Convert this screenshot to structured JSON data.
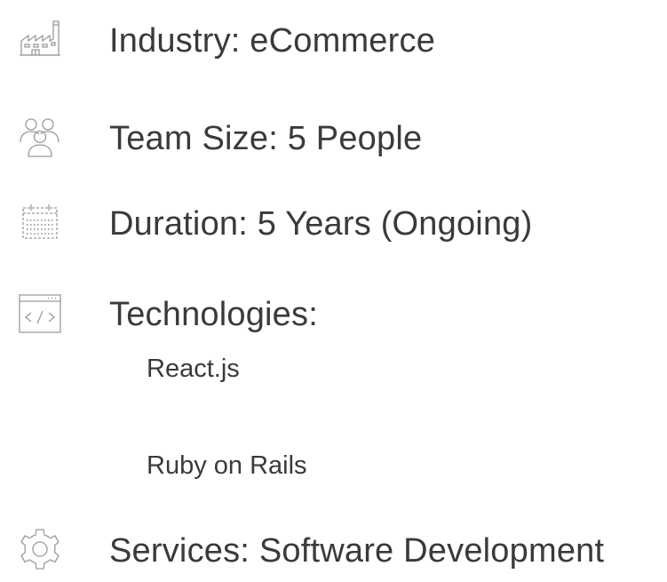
{
  "details": {
    "industry": {
      "label": "Industry: eCommerce",
      "icon": "factory-icon"
    },
    "team_size": {
      "label": "Team Size: 5 People",
      "icon": "team-icon"
    },
    "duration": {
      "label": "Duration: 5 Years (Ongoing)",
      "icon": "calendar-icon"
    },
    "technologies": {
      "label": "Technologies:",
      "icon": "code-window-icon",
      "items": [
        "React.js",
        "Ruby on Rails"
      ]
    },
    "services": {
      "label": "Services: Software Development",
      "icon": "gear-icon"
    }
  },
  "colors": {
    "icon_stroke": "#9a9a9a",
    "text": "#3a3a3a",
    "background": "#ffffff"
  }
}
